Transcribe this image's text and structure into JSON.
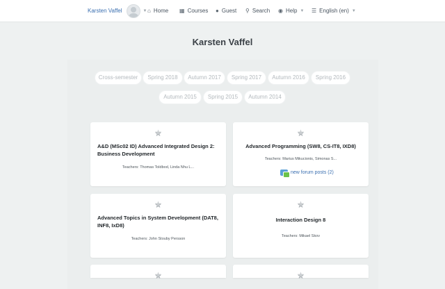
{
  "nav": {
    "user_name": "Karsten Vaffel",
    "home": "Home",
    "courses": "Courses",
    "guest": "Guest",
    "search": "Search",
    "help": "Help",
    "language": "English (en)"
  },
  "page_title": "Karsten Vaffel",
  "tabs": [
    "Cross-semester",
    "Spring 2018",
    "Autumn 2017",
    "Spring 2017",
    "Autumn 2016",
    "Spring 2016",
    "Autumn 2015",
    "Spring 2015",
    "Autumn 2014"
  ],
  "courses": [
    {
      "title": "A&D (MSc02 ID) Advanced Integrated Design 2: Business Development",
      "teachers": "Teachers: Thomas Toldbod, Linda Nhu L..."
    },
    {
      "title": "Advanced Programming (SW8, CS-IT8, IXD8)",
      "teachers": "Teachers: Marius Mikucionis, Simonas S...",
      "forum": "new forum posts (2)"
    },
    {
      "title": "Advanced Topics in System Development (DAT8, INF8, IxD8)",
      "teachers": "Teachers: John Stouby Persson"
    },
    {
      "title": "Interaction Design 8",
      "teachers": "Teachers: Mikael Skov"
    }
  ],
  "colors": {
    "background": "#eef1f1",
    "link": "#3a6fb0",
    "card": "#ffffff"
  }
}
